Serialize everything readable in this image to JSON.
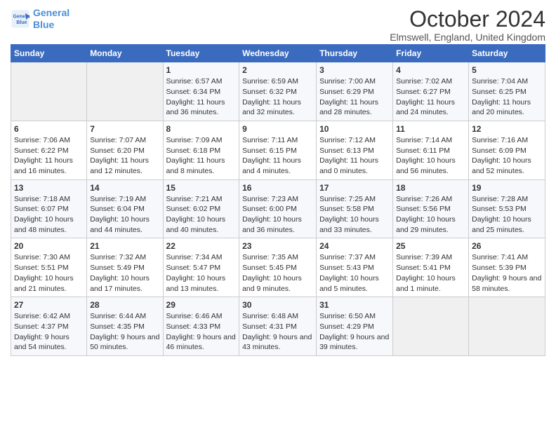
{
  "header": {
    "logo_line1": "General",
    "logo_line2": "Blue",
    "title": "October 2024",
    "location": "Elmswell, England, United Kingdom"
  },
  "weekdays": [
    "Sunday",
    "Monday",
    "Tuesday",
    "Wednesday",
    "Thursday",
    "Friday",
    "Saturday"
  ],
  "weeks": [
    [
      {
        "day": "",
        "sunrise": "",
        "sunset": "",
        "daylight": ""
      },
      {
        "day": "",
        "sunrise": "",
        "sunset": "",
        "daylight": ""
      },
      {
        "day": "1",
        "sunrise": "Sunrise: 6:57 AM",
        "sunset": "Sunset: 6:34 PM",
        "daylight": "Daylight: 11 hours and 36 minutes."
      },
      {
        "day": "2",
        "sunrise": "Sunrise: 6:59 AM",
        "sunset": "Sunset: 6:32 PM",
        "daylight": "Daylight: 11 hours and 32 minutes."
      },
      {
        "day": "3",
        "sunrise": "Sunrise: 7:00 AM",
        "sunset": "Sunset: 6:29 PM",
        "daylight": "Daylight: 11 hours and 28 minutes."
      },
      {
        "day": "4",
        "sunrise": "Sunrise: 7:02 AM",
        "sunset": "Sunset: 6:27 PM",
        "daylight": "Daylight: 11 hours and 24 minutes."
      },
      {
        "day": "5",
        "sunrise": "Sunrise: 7:04 AM",
        "sunset": "Sunset: 6:25 PM",
        "daylight": "Daylight: 11 hours and 20 minutes."
      }
    ],
    [
      {
        "day": "6",
        "sunrise": "Sunrise: 7:06 AM",
        "sunset": "Sunset: 6:22 PM",
        "daylight": "Daylight: 11 hours and 16 minutes."
      },
      {
        "day": "7",
        "sunrise": "Sunrise: 7:07 AM",
        "sunset": "Sunset: 6:20 PM",
        "daylight": "Daylight: 11 hours and 12 minutes."
      },
      {
        "day": "8",
        "sunrise": "Sunrise: 7:09 AM",
        "sunset": "Sunset: 6:18 PM",
        "daylight": "Daylight: 11 hours and 8 minutes."
      },
      {
        "day": "9",
        "sunrise": "Sunrise: 7:11 AM",
        "sunset": "Sunset: 6:15 PM",
        "daylight": "Daylight: 11 hours and 4 minutes."
      },
      {
        "day": "10",
        "sunrise": "Sunrise: 7:12 AM",
        "sunset": "Sunset: 6:13 PM",
        "daylight": "Daylight: 11 hours and 0 minutes."
      },
      {
        "day": "11",
        "sunrise": "Sunrise: 7:14 AM",
        "sunset": "Sunset: 6:11 PM",
        "daylight": "Daylight: 10 hours and 56 minutes."
      },
      {
        "day": "12",
        "sunrise": "Sunrise: 7:16 AM",
        "sunset": "Sunset: 6:09 PM",
        "daylight": "Daylight: 10 hours and 52 minutes."
      }
    ],
    [
      {
        "day": "13",
        "sunrise": "Sunrise: 7:18 AM",
        "sunset": "Sunset: 6:07 PM",
        "daylight": "Daylight: 10 hours and 48 minutes."
      },
      {
        "day": "14",
        "sunrise": "Sunrise: 7:19 AM",
        "sunset": "Sunset: 6:04 PM",
        "daylight": "Daylight: 10 hours and 44 minutes."
      },
      {
        "day": "15",
        "sunrise": "Sunrise: 7:21 AM",
        "sunset": "Sunset: 6:02 PM",
        "daylight": "Daylight: 10 hours and 40 minutes."
      },
      {
        "day": "16",
        "sunrise": "Sunrise: 7:23 AM",
        "sunset": "Sunset: 6:00 PM",
        "daylight": "Daylight: 10 hours and 36 minutes."
      },
      {
        "day": "17",
        "sunrise": "Sunrise: 7:25 AM",
        "sunset": "Sunset: 5:58 PM",
        "daylight": "Daylight: 10 hours and 33 minutes."
      },
      {
        "day": "18",
        "sunrise": "Sunrise: 7:26 AM",
        "sunset": "Sunset: 5:56 PM",
        "daylight": "Daylight: 10 hours and 29 minutes."
      },
      {
        "day": "19",
        "sunrise": "Sunrise: 7:28 AM",
        "sunset": "Sunset: 5:53 PM",
        "daylight": "Daylight: 10 hours and 25 minutes."
      }
    ],
    [
      {
        "day": "20",
        "sunrise": "Sunrise: 7:30 AM",
        "sunset": "Sunset: 5:51 PM",
        "daylight": "Daylight: 10 hours and 21 minutes."
      },
      {
        "day": "21",
        "sunrise": "Sunrise: 7:32 AM",
        "sunset": "Sunset: 5:49 PM",
        "daylight": "Daylight: 10 hours and 17 minutes."
      },
      {
        "day": "22",
        "sunrise": "Sunrise: 7:34 AM",
        "sunset": "Sunset: 5:47 PM",
        "daylight": "Daylight: 10 hours and 13 minutes."
      },
      {
        "day": "23",
        "sunrise": "Sunrise: 7:35 AM",
        "sunset": "Sunset: 5:45 PM",
        "daylight": "Daylight: 10 hours and 9 minutes."
      },
      {
        "day": "24",
        "sunrise": "Sunrise: 7:37 AM",
        "sunset": "Sunset: 5:43 PM",
        "daylight": "Daylight: 10 hours and 5 minutes."
      },
      {
        "day": "25",
        "sunrise": "Sunrise: 7:39 AM",
        "sunset": "Sunset: 5:41 PM",
        "daylight": "Daylight: 10 hours and 1 minute."
      },
      {
        "day": "26",
        "sunrise": "Sunrise: 7:41 AM",
        "sunset": "Sunset: 5:39 PM",
        "daylight": "Daylight: 9 hours and 58 minutes."
      }
    ],
    [
      {
        "day": "27",
        "sunrise": "Sunrise: 6:42 AM",
        "sunset": "Sunset: 4:37 PM",
        "daylight": "Daylight: 9 hours and 54 minutes."
      },
      {
        "day": "28",
        "sunrise": "Sunrise: 6:44 AM",
        "sunset": "Sunset: 4:35 PM",
        "daylight": "Daylight: 9 hours and 50 minutes."
      },
      {
        "day": "29",
        "sunrise": "Sunrise: 6:46 AM",
        "sunset": "Sunset: 4:33 PM",
        "daylight": "Daylight: 9 hours and 46 minutes."
      },
      {
        "day": "30",
        "sunrise": "Sunrise: 6:48 AM",
        "sunset": "Sunset: 4:31 PM",
        "daylight": "Daylight: 9 hours and 43 minutes."
      },
      {
        "day": "31",
        "sunrise": "Sunrise: 6:50 AM",
        "sunset": "Sunset: 4:29 PM",
        "daylight": "Daylight: 9 hours and 39 minutes."
      },
      {
        "day": "",
        "sunrise": "",
        "sunset": "",
        "daylight": ""
      },
      {
        "day": "",
        "sunrise": "",
        "sunset": "",
        "daylight": ""
      }
    ]
  ]
}
